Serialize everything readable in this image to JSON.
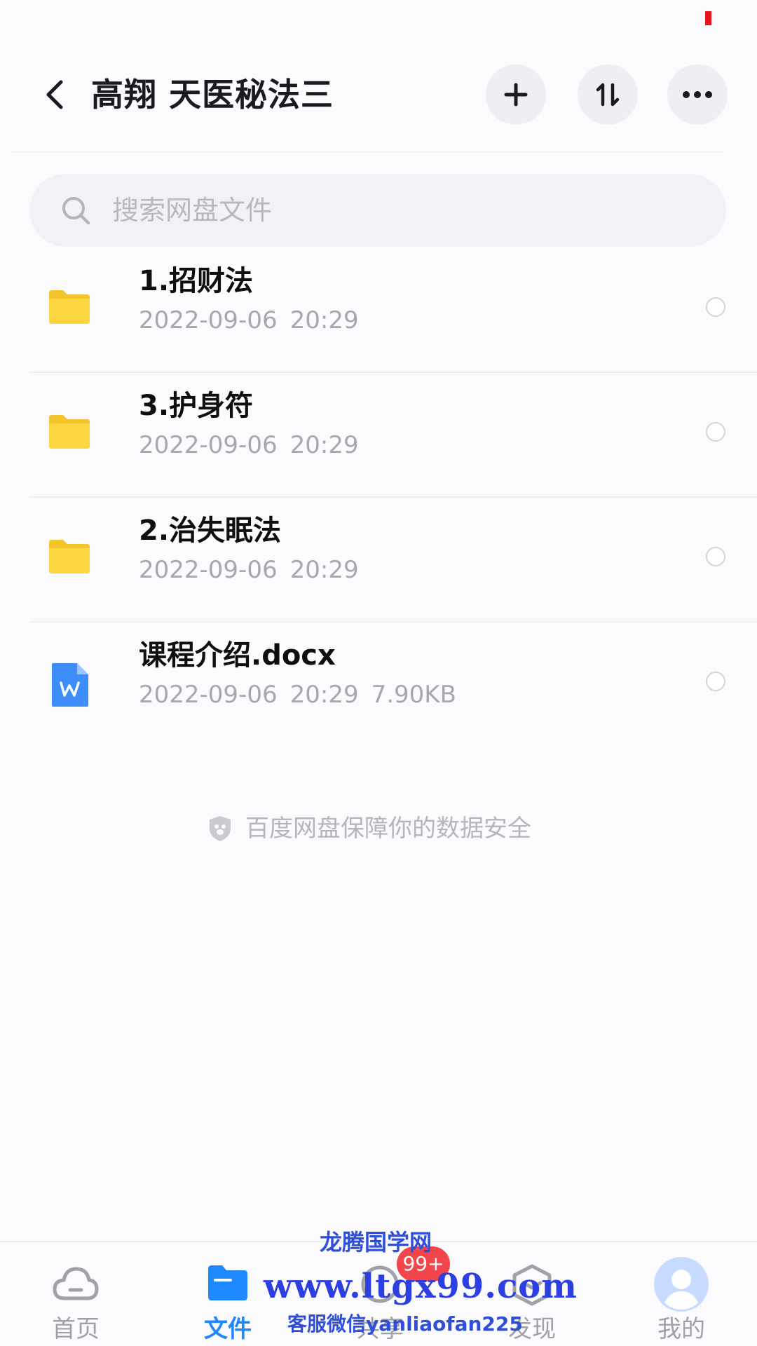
{
  "header": {
    "title": "高翔 天医秘法三",
    "back_icon": "chevron-left-icon",
    "actions": [
      {
        "name": "add",
        "icon": "plus-icon"
      },
      {
        "name": "sort",
        "icon": "sort-icon"
      },
      {
        "name": "more",
        "icon": "ellipsis-icon"
      }
    ]
  },
  "search": {
    "placeholder": "搜索网盘文件"
  },
  "files": [
    {
      "name": "1.招财法",
      "date": "2022-09-06",
      "time": "20:29",
      "size": "",
      "type": "folder"
    },
    {
      "name": "3.护身符",
      "date": "2022-09-06",
      "time": "20:29",
      "size": "",
      "type": "folder"
    },
    {
      "name": "2.治失眠法",
      "date": "2022-09-06",
      "time": "20:29",
      "size": "",
      "type": "folder"
    },
    {
      "name": "课程介绍.docx",
      "date": "2022-09-06",
      "time": "20:29",
      "size": "7.90KB",
      "type": "docx"
    }
  ],
  "security_note": "百度网盘保障你的数据安全",
  "bottom_nav": {
    "home": "首页",
    "files": "文件",
    "share": "共享",
    "discover": "发现",
    "me": "我的",
    "active": "files",
    "share_badge": "99+"
  },
  "watermark": {
    "site_name": "龙腾国学网",
    "url": "www.ltgx99.com",
    "contact": "客服微信yanliaofan225"
  },
  "colors": {
    "accent": "#1e88ff",
    "folder": "#fbd338",
    "badge": "#f2454c",
    "watermark": "#2c3fe0"
  }
}
